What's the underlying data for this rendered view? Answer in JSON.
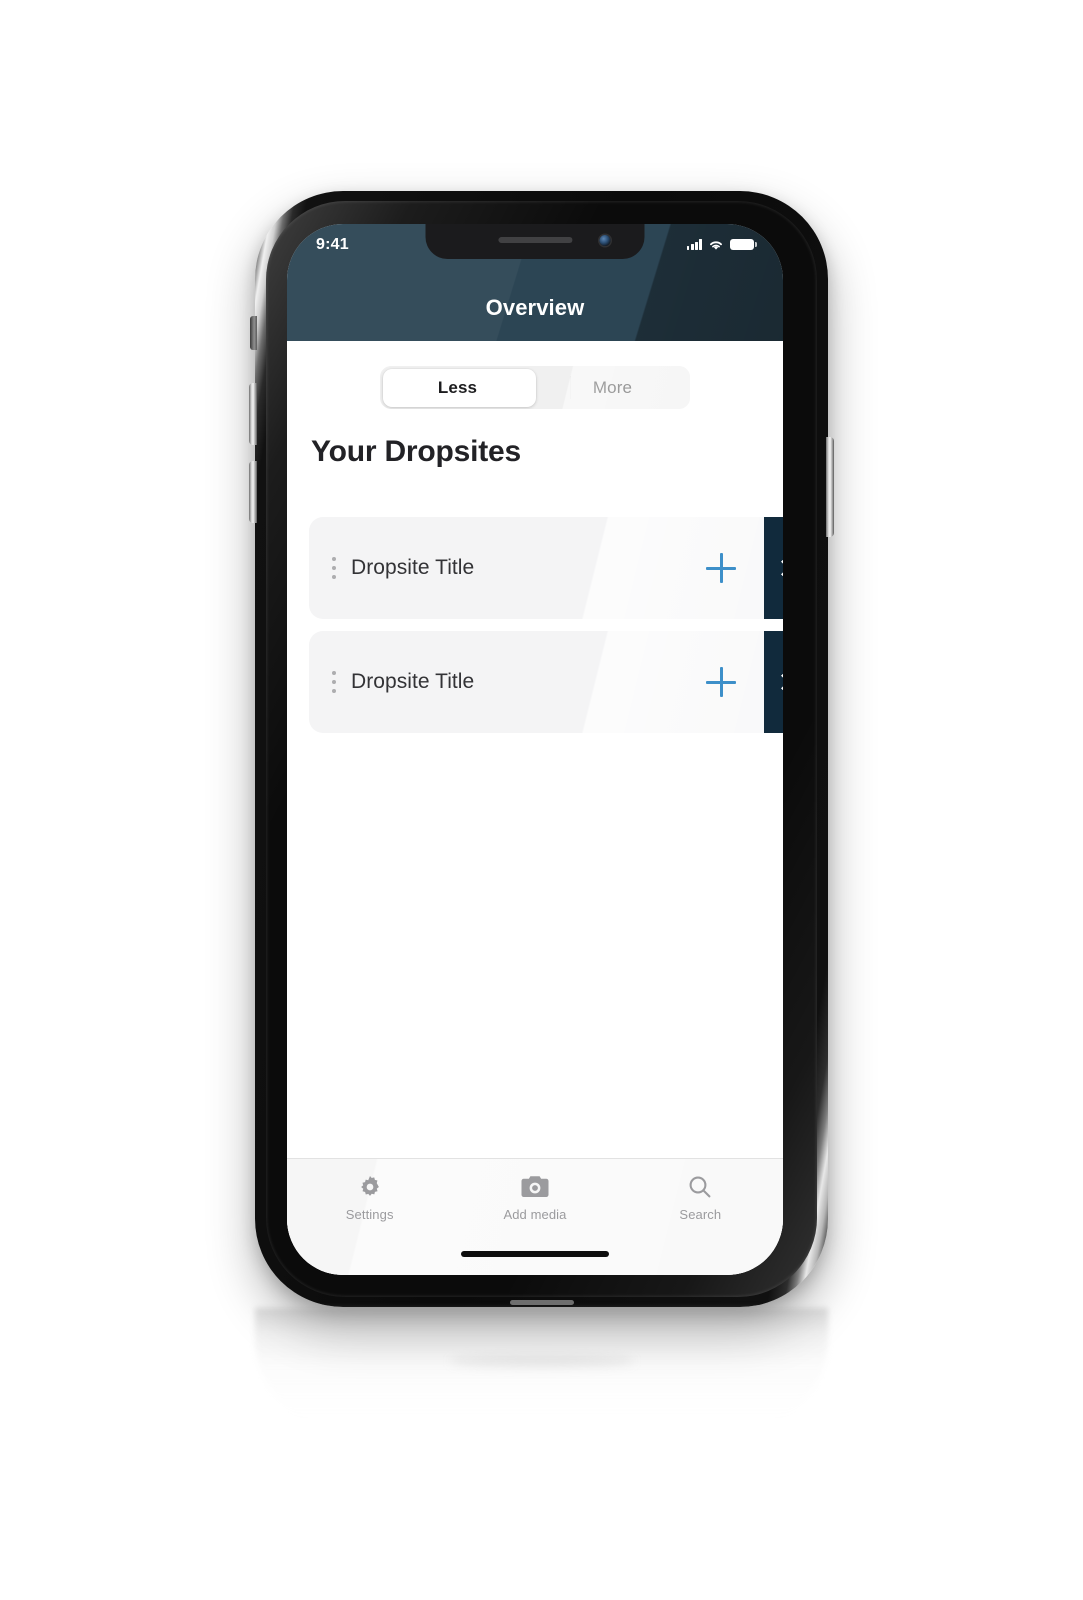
{
  "status_bar": {
    "time": "9:41",
    "cellular_icon": "cellular-bars-icon",
    "wifi_icon": "wifi-icon",
    "battery_icon": "battery-full-icon"
  },
  "header": {
    "title": "Overview",
    "background_color": "#2c4554"
  },
  "segmented_control": {
    "options": [
      {
        "label": "Less",
        "selected": true
      },
      {
        "label": "More",
        "selected": false
      }
    ]
  },
  "section": {
    "heading": "Your Dropsites"
  },
  "dropsites": [
    {
      "title": "Dropsite Title",
      "drag_handle_icon": "drag-handle-dots-icon",
      "add_icon": "plus-icon",
      "chevron_icon": "chevron-right-icon"
    },
    {
      "title": "Dropsite Title",
      "drag_handle_icon": "drag-handle-dots-icon",
      "add_icon": "plus-icon",
      "chevron_icon": "chevron-right-icon"
    }
  ],
  "tab_bar": {
    "items": [
      {
        "label": "Settings",
        "icon": "gear-icon"
      },
      {
        "label": "Add media",
        "icon": "camera-icon"
      },
      {
        "label": "Search",
        "icon": "search-icon"
      }
    ]
  },
  "colors": {
    "accent_blue": "#3d8fc9",
    "chevron_button": "#112a3c",
    "row_background": "#f4f4f5",
    "tab_label": "#9b9b9e"
  }
}
